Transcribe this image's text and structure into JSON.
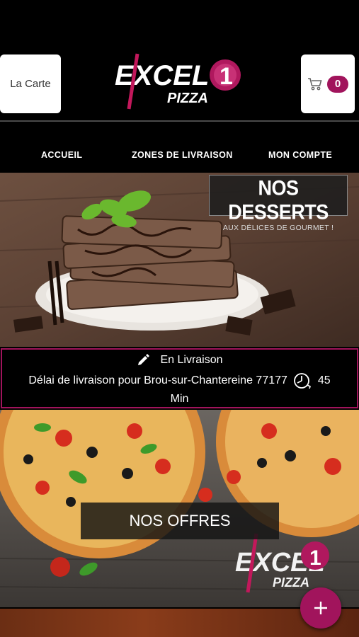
{
  "header": {
    "carte_label": "La Carte",
    "cart_count": "0",
    "cart_icon": "cart-icon",
    "logo_top": "EXCEL",
    "logo_number": "1",
    "logo_bottom": "PIZZA"
  },
  "nav": {
    "items": [
      {
        "label": "ACCUEIL"
      },
      {
        "label": "ZONES DE LIVRAISON"
      },
      {
        "label": "MON COMPTE"
      }
    ]
  },
  "desserts_banner": {
    "title": "NOS DESSERTS",
    "subtitle": "AUX DÉLICES DE GOURMET !"
  },
  "delivery": {
    "mode_icon": "pencil-icon",
    "mode": "En Livraison",
    "delay_text": "Délai de livraison pour Brou-sur-Chantereine 77177",
    "clock_icon": "clock-icon",
    "delay_value": "45",
    "delay_unit": "Min"
  },
  "offers_banner": {
    "button_label": "NOS OFFRES",
    "logo_top": "EXCEL",
    "logo_number": "1",
    "logo_bottom": "PIZZA"
  },
  "fab": {
    "icon": "plus-icon"
  },
  "colors": {
    "accent": "#a1145c",
    "background": "#000000"
  }
}
